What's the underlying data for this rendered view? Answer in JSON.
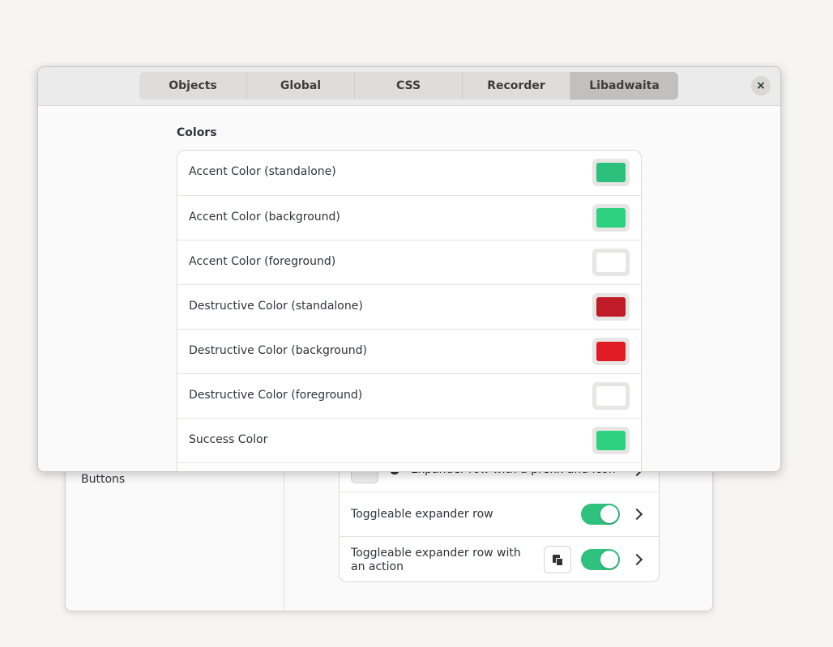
{
  "background_window": {
    "sidebar": {
      "items": [
        {
          "label": "Buttons"
        }
      ]
    },
    "rows": [
      {
        "label": "Expander row with a prefix and icon"
      },
      {
        "label": "Toggleable expander row",
        "toggle_on": true
      },
      {
        "label": "Toggleable expander row with an action",
        "toggle_on": true,
        "action_icon": "copy-icon"
      }
    ]
  },
  "inspector": {
    "tabs": [
      {
        "label": "Objects",
        "active": false
      },
      {
        "label": "Global",
        "active": false
      },
      {
        "label": "CSS",
        "active": false
      },
      {
        "label": "Recorder",
        "active": false
      },
      {
        "label": "Libadwaita",
        "active": true
      }
    ],
    "close_icon": "×",
    "section_title": "Colors",
    "colors": [
      {
        "label": "Accent Color (standalone)",
        "color": "#2bc07b"
      },
      {
        "label": "Accent Color (background)",
        "color": "#2ed17f"
      },
      {
        "label": "Accent Color (foreground)",
        "color": "#ffffff"
      },
      {
        "label": "Destructive Color (standalone)",
        "color": "#c01c28"
      },
      {
        "label": "Destructive Color (background)",
        "color": "#e01b24"
      },
      {
        "label": "Destructive Color (foreground)",
        "color": "#ffffff"
      },
      {
        "label": "Success Color",
        "color": "#2ed17f"
      },
      {
        "label": "",
        "color": "#ffffff"
      }
    ]
  },
  "accent_color": "#2ec27e"
}
